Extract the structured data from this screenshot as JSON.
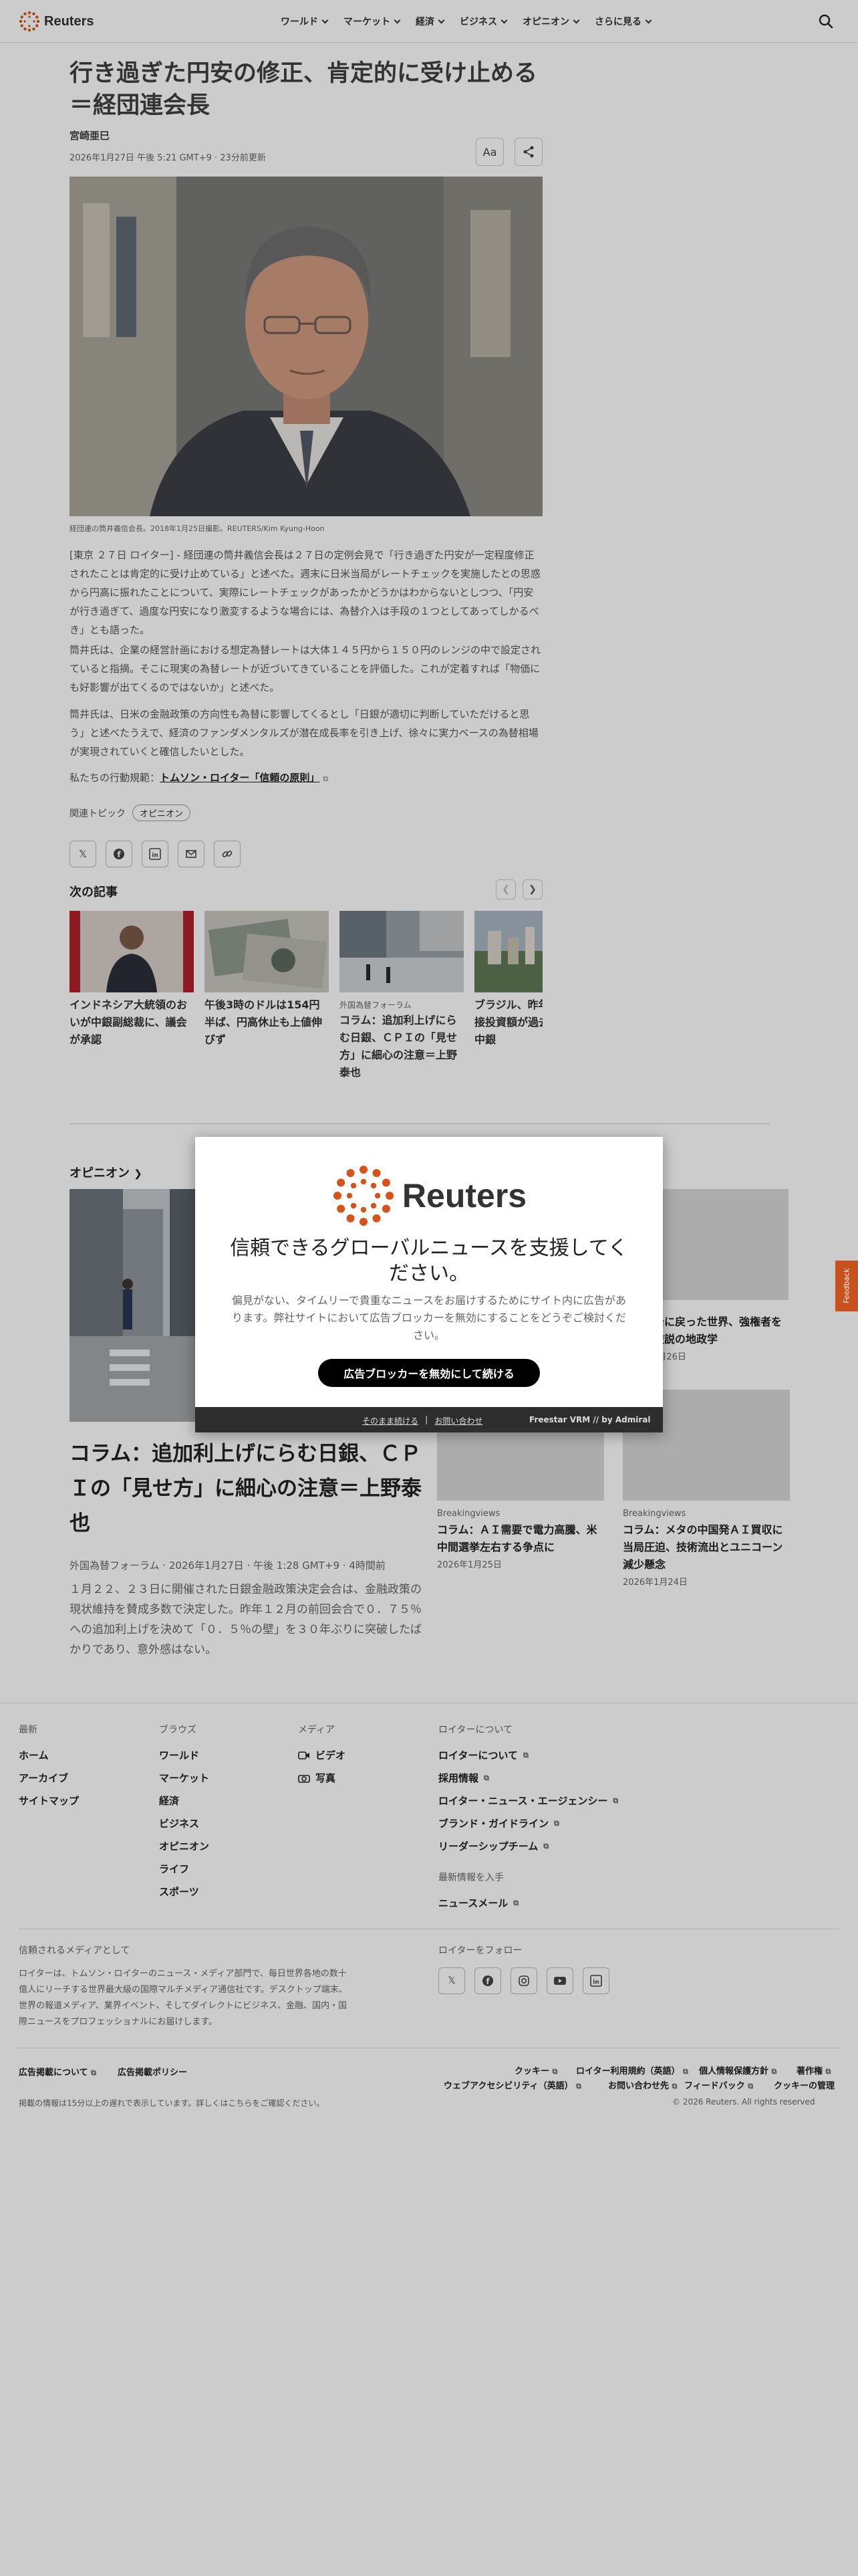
{
  "header": {
    "brand": "Reuters",
    "nav": [
      "ワールド",
      "マーケット",
      "経済",
      "ビジネス",
      "オピニオン",
      "さらに見る"
    ]
  },
  "article": {
    "title": "行き過ぎた円安の修正、肯定的に受け止める＝経団連会長",
    "author": "宮崎亜巳",
    "date": "2026年1月27日 午後 5:21 GMT+9 · 23分前更新",
    "text_size_label": "Aa",
    "photo_caption": "経団連の筒井義信会長。2018年1月25日撮影。REUTERS/Kim Kyung-Hoon",
    "paragraphs": [
      "[東京 ２７日 ロイター] - 経団連の筒井義信会長は２７日の定例会見で「行き過ぎた円安が一定程度修正されたことは肯定的に受け止めている」と述べた。週末に日米当局がレートチェックを実施したとの思惑から円高に振れたことについて、実際にレートチェックがあったかどうかはわからないとしつつ、「円安が行き過ぎて、過度な円安になり激変するような場合には、為替介入は手段の１つとしてあってしかるべき」とも語った。",
      "筒井氏は、企業の経営計画における想定為替レートは大体１４５円から１５０円のレンジの中で設定されていると指摘。そこに現実の為替レートが近づいてきていることを評価した。これが定着すれば「物価にも好影響が出てくるのではないか」と述べた。",
      "筒井氏は、日米の金融政策の方向性も為替に影響してくるとし「日銀が適切に判断していただけると思う」と述べたうえで、経済のファンダメンタルズが潜在成長率を引き上げ、徐々に実力ベースの為替相場が実現されていくと確信したいとした。"
    ],
    "principles_prefix": "私たちの行動規範：",
    "principles_link": "トムソン・ロイター「信頼の原則」",
    "topics_label": "関連トピック",
    "topic": "オピニオン"
  },
  "share_icons": [
    "x-icon",
    "facebook-icon",
    "linkedin-icon",
    "email-icon",
    "link-icon"
  ],
  "next": {
    "heading": "次の記事",
    "cards": [
      {
        "kicker": "",
        "title": "インドネシア大統領のおいが中銀副総裁に、議会が承認"
      },
      {
        "kicker": "",
        "title": "午後3時のドルは154円半ば、円高休止も上値伸びず"
      },
      {
        "kicker": "外国為替フォーラム",
        "title": "コラム：追加利上げにらむ日銀、ＣＰＩの「見せ方」に細心の注意＝上野泰也"
      },
      {
        "kicker": "",
        "title": "ブラジル、昨年の外国直接投資額が過去最高に＝中銀"
      }
    ]
  },
  "opinion": {
    "heading": "オピニオン",
    "main_title": "コラム：追加利上げにらむ日銀、ＣＰＩの「見せ方」に細心の注意＝上野泰也",
    "main_meta": "外国為替フォーラム · 2026年1月27日 · 午後 1:28 GMT+9 · 4時間前",
    "main_summary": "１月２２、２３日に開催された日銀金融政策決定会合は、金融政策の現状維持を賛成多数で決定した。昨年１２月の前回会合で０．７５％への追加利上げを決めて「０．５％の壁」を３０年ぶりに突破したばかりであり、意外感はない。",
    "side": [
      {
        "kicker": "",
        "title": "米国政治に戻った世界、強権者を恐れる逆説の地政学",
        "date": "2026年1月26日"
      },
      {
        "kicker": "Breakingviews",
        "title": "コラム：ＡＩ需要で電力高騰、米中間選挙左右する争点に",
        "date": "2026年1月25日"
      },
      {
        "kicker": "Breakingviews",
        "title": "コラム：メタの中国発ＡＩ買収に当局圧迫、技術流出とユニコーン減少懸念",
        "date": "2026年1月24日"
      }
    ]
  },
  "footer": {
    "latest_h": "最新",
    "latest": [
      "ホーム",
      "アーカイブ",
      "サイトマップ"
    ],
    "browse_h": "ブラウズ",
    "browse": [
      "ワールド",
      "マーケット",
      "経済",
      "ビジネス",
      "オピニオン",
      "ライフ",
      "スポーツ"
    ],
    "media_h": "メディア",
    "media": [
      "ビデオ",
      "写真"
    ],
    "about_h": "ロイターについて",
    "about": [
      "ロイターについて",
      "採用情報",
      "ロイター・ニュース・エージェンシー",
      "ブランド・ガイドライン",
      "リーダーシップチーム"
    ],
    "news_h": "最新情報を入手",
    "newsletter": "ニュースメール",
    "trusted_h": "信頼されるメディアとして",
    "trusted_text": "ロイターは、トムソン・ロイターのニュース・メディア部門で、毎日世界各地の数十億人にリーチする世界最大級の国際マルチメディア通信社です。デスクトップ端末、世界の報道メディア、業界イベント、そしてダイレクトにビジネス、金融、国内・国際ニュースをプロフェッショナルにお届けします。",
    "follow_h": "ロイターをフォロー",
    "ads": "広告掲載について",
    "ads_policy": "広告掲載ポリシー",
    "legal_row1": [
      "クッキー",
      "ロイター利用規約（英語）",
      "個人情報保護方針",
      "著作権"
    ],
    "legal_row2": [
      "ウェブアクセシビリティ（英語）",
      "お問い合わせ先",
      "フィードバック",
      "クッキーの管理"
    ],
    "delay_note": "掲載の情報は15分以上の遅れで表示しています。詳しくはこちらをご確認ください。",
    "copyright": "© 2026 Reuters. All rights reserved"
  },
  "modal": {
    "brand": "Reuters",
    "title": "信頼できるグローバルニュースを支援してください。",
    "desc": "偏見がない、タイムリーで貴重なニュースをお届けするためにサイト内に広告があります。弊社サイトにおいて広告ブロッカーを無効にすることをどうぞご検討ください。",
    "button": "広告ブロッカーを無効にして続ける",
    "link1": "そのまま続ける",
    "link2": "お問い合わせ",
    "provider": "Freestar VRM // by Admiral"
  },
  "feedback_tab": "Feedback",
  "colors": {
    "brand_orange": "#d4531b",
    "feedback": "#c8511e"
  }
}
